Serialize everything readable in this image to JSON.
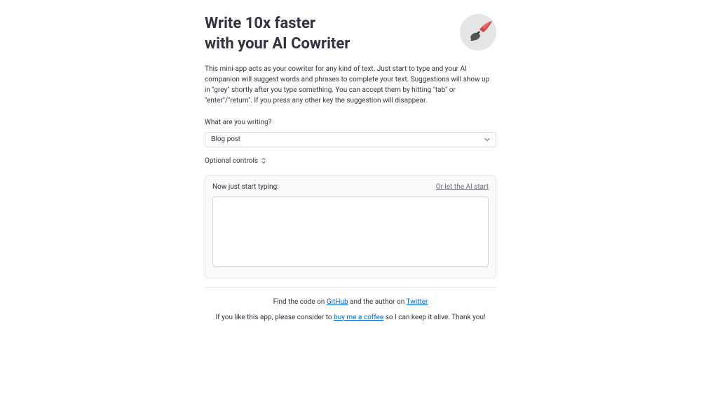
{
  "header": {
    "title_line1": "Write 10x faster",
    "title_line2": "with your AI Cowriter"
  },
  "description": "This mini-app acts as your cowriter for any kind of text. Just start to type and your AI companion will suggest words and phrases to complete your text. Suggestions will show up in \"grey\" shortly after you type something. You can accept them by hitting \"tab\" or \"enter\"/\"return\". If you press any other key the suggestion will disappear.",
  "form": {
    "writing_type_label": "What are you writing?",
    "writing_type_value": "Blog post",
    "optional_controls_label": "Optional controls"
  },
  "editor": {
    "typing_label": "Now just start typing:",
    "ai_start_label": "Or let the AI start"
  },
  "footer": {
    "code_prefix": "Find the code on ",
    "github_label": "GitHub",
    "author_mid": " and the author on ",
    "twitter_label": "Twitter",
    "support_prefix": "If you like this app, please consider to ",
    "coffee_label": "buy me a coffee",
    "support_suffix": " so I can keep it alive. Thank you!"
  }
}
